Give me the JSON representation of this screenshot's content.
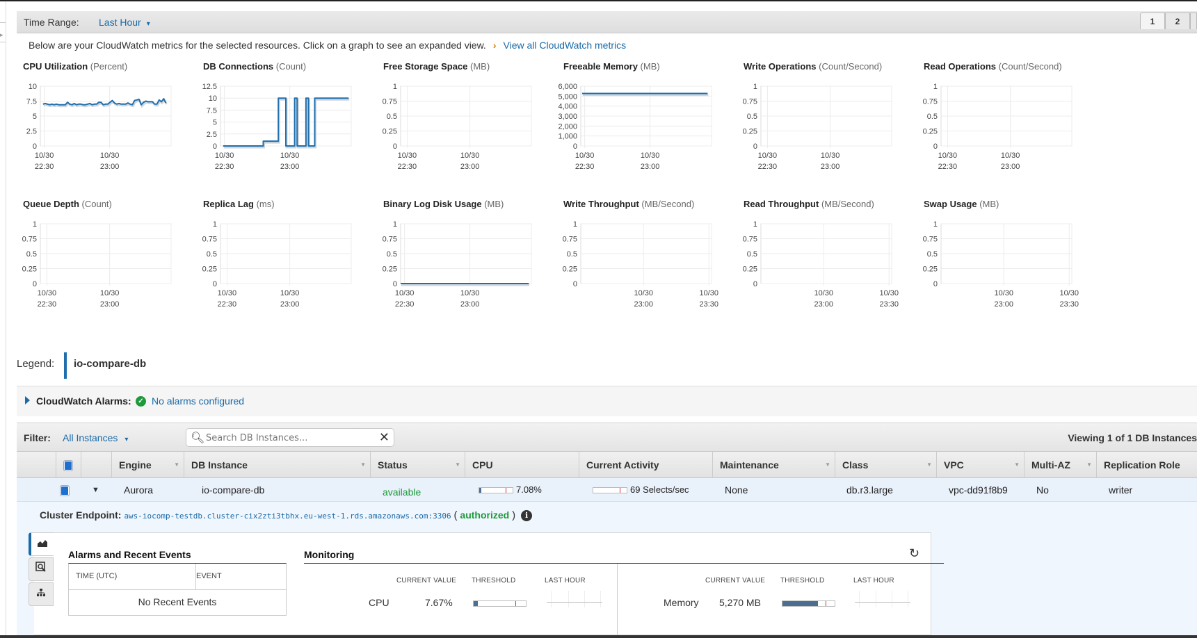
{
  "time_range": {
    "label": "Time Range:",
    "value": "Last Hour"
  },
  "pagination": [
    "1",
    "2"
  ],
  "intro": {
    "text": "Below are your CloudWatch metrics for the selected resources. Click on a graph to see an expanded view.",
    "link": "View all CloudWatch metrics"
  },
  "chart_data": [
    {
      "type": "line",
      "title": "CPU Utilization",
      "unit": "(Percent)",
      "ylim": [
        0,
        10
      ],
      "yticks": [
        "10",
        "7.5",
        "5",
        "2.5",
        "0"
      ],
      "ytick_values": [
        10,
        7.5,
        5,
        2.5,
        0
      ],
      "xticks": [
        {
          "date": "10/30",
          "time": "22:30",
          "pos": 0.03
        },
        {
          "date": "10/30",
          "time": "23:00",
          "pos": 0.53
        }
      ],
      "series": [
        {
          "name": "io-compare-db",
          "values": [
            7.0,
            7.1,
            7.0,
            6.9,
            7.0,
            6.9,
            7.0,
            6.9,
            6.9,
            6.9,
            6.9,
            7.3,
            7.0,
            6.9,
            7.1,
            6.9,
            7.0,
            7.0,
            6.9,
            6.9,
            7.0,
            7.1,
            6.9,
            7.0,
            7.0,
            7.3,
            7.3,
            6.9,
            7.0,
            7.0,
            7.3,
            7.6,
            7.2,
            7.0,
            7.1,
            7.0,
            7.0,
            7.0,
            7.2,
            7.0,
            6.9,
            7.6,
            7.7,
            7.8,
            6.9,
            7.3,
            7.5,
            7.4,
            7.4,
            7.4,
            7.0,
            7.0,
            7.7,
            7.4,
            7.9,
            7.2
          ]
        }
      ],
      "x_range": [
        0.02,
        0.96
      ]
    },
    {
      "type": "line",
      "step": true,
      "title": "DB Connections",
      "unit": "(Count)",
      "ylim": [
        0,
        12.5
      ],
      "yticks": [
        "12.5",
        "10",
        "7.5",
        "5",
        "2.5",
        "0"
      ],
      "ytick_values": [
        12.5,
        10,
        7.5,
        5,
        2.5,
        0
      ],
      "xticks": [
        {
          "date": "10/30",
          "time": "22:30",
          "pos": 0.03
        },
        {
          "date": "10/30",
          "time": "23:00",
          "pos": 0.53
        }
      ],
      "series": [
        {
          "name": "io-compare-db",
          "points": [
            [
              0.0,
              0
            ],
            [
              0.32,
              0
            ],
            [
              0.32,
              1
            ],
            [
              0.44,
              1
            ],
            [
              0.44,
              10
            ],
            [
              0.5,
              10
            ],
            [
              0.5,
              0
            ],
            [
              0.57,
              0
            ],
            [
              0.57,
              10
            ],
            [
              0.59,
              10
            ],
            [
              0.59,
              0
            ],
            [
              0.66,
              0
            ],
            [
              0.66,
              10
            ],
            [
              0.68,
              10
            ],
            [
              0.68,
              0
            ],
            [
              0.73,
              0
            ],
            [
              0.73,
              10
            ],
            [
              1.0,
              10
            ]
          ]
        }
      ],
      "x_range": [
        0.02,
        0.98
      ]
    },
    {
      "type": "line",
      "title": "Free Storage Space",
      "unit": "(MB)",
      "ylim": [
        0,
        1
      ],
      "yticks": [
        "1",
        "0.75",
        "0.5",
        "0.25",
        "0"
      ],
      "ytick_values": [
        1,
        0.75,
        0.5,
        0.25,
        0
      ],
      "xticks": [
        {
          "date": "10/30",
          "time": "22:30",
          "pos": 0.05
        },
        {
          "date": "10/30",
          "time": "23:00",
          "pos": 0.53
        }
      ],
      "series": []
    },
    {
      "type": "line",
      "title": "Freeable Memory",
      "unit": "(MB)",
      "ylim": [
        0,
        6000
      ],
      "yticks": [
        "6,000",
        "5,000",
        "4,000",
        "3,000",
        "2,000",
        "1,000",
        "0"
      ],
      "ytick_values": [
        6000,
        5000,
        4000,
        3000,
        2000,
        1000,
        0
      ],
      "xticks": [
        {
          "date": "10/30",
          "time": "22:30",
          "pos": 0.03
        },
        {
          "date": "10/30",
          "time": "23:00",
          "pos": 0.53
        }
      ],
      "series": [
        {
          "name": "io-compare-db",
          "points": [
            [
              0.0,
              5270
            ],
            [
              1.0,
              5270
            ]
          ]
        }
      ],
      "x_range": [
        0.01,
        0.97
      ]
    },
    {
      "type": "line",
      "title": "Write Operations",
      "unit": "(Count/Second)",
      "ylim": [
        0,
        1
      ],
      "yticks": [
        "1",
        "0.75",
        "0.5",
        "0.25",
        "0"
      ],
      "ytick_values": [
        1,
        0.75,
        0.5,
        0.25,
        0
      ],
      "xticks": [
        {
          "date": "10/30",
          "time": "22:30",
          "pos": 0.05
        },
        {
          "date": "10/30",
          "time": "23:00",
          "pos": 0.53
        }
      ],
      "series": []
    },
    {
      "type": "line",
      "title": "Read Operations",
      "unit": "(Count/Second)",
      "ylim": [
        0,
        1
      ],
      "yticks": [
        "1",
        "0.75",
        "0.5",
        "0.25",
        "0"
      ],
      "ytick_values": [
        1,
        0.75,
        0.5,
        0.25,
        0
      ],
      "xticks": [
        {
          "date": "10/30",
          "time": "22:30",
          "pos": 0.05
        },
        {
          "date": "10/30",
          "time": "23:00",
          "pos": 0.53
        }
      ],
      "series": []
    },
    {
      "type": "line",
      "title": "Queue Depth",
      "unit": "(Count)",
      "ylim": [
        0,
        1
      ],
      "yticks": [
        "1",
        "0.75",
        "0.5",
        "0.25",
        "0"
      ],
      "ytick_values": [
        1,
        0.75,
        0.5,
        0.25,
        0
      ],
      "xticks": [
        {
          "date": "10/30",
          "time": "22:30",
          "pos": 0.05
        },
        {
          "date": "10/30",
          "time": "23:00",
          "pos": 0.53
        }
      ],
      "series": []
    },
    {
      "type": "line",
      "title": "Replica Lag",
      "unit": "(ms)",
      "ylim": [
        0,
        1
      ],
      "yticks": [
        "1",
        "0.75",
        "0.5",
        "0.25",
        "0"
      ],
      "ytick_values": [
        1,
        0.75,
        0.5,
        0.25,
        0
      ],
      "xticks": [
        {
          "date": "10/30",
          "time": "22:30",
          "pos": 0.05
        },
        {
          "date": "10/30",
          "time": "23:00",
          "pos": 0.53
        }
      ],
      "series": []
    },
    {
      "type": "line",
      "title": "Binary Log Disk Usage",
      "unit": "(MB)",
      "ylim": [
        0,
        1
      ],
      "yticks": [
        "1",
        "0.75",
        "0.5",
        "0.25",
        "0"
      ],
      "ytick_values": [
        1,
        0.75,
        0.5,
        0.25,
        0
      ],
      "xticks": [
        {
          "date": "10/30",
          "time": "22:30",
          "pos": 0.03
        },
        {
          "date": "10/30",
          "time": "23:00",
          "pos": 0.53
        }
      ],
      "series": [
        {
          "name": "io-compare-db",
          "points": [
            [
              0.0,
              0
            ],
            [
              1.0,
              0
            ]
          ]
        }
      ],
      "x_range": [
        0.0,
        0.98
      ]
    },
    {
      "type": "line",
      "title": "Write Throughput",
      "unit": "(MB/Second)",
      "ylim": [
        0,
        1
      ],
      "yticks": [
        "1",
        "0.75",
        "0.5",
        "0.25",
        "0"
      ],
      "ytick_values": [
        1,
        0.75,
        0.5,
        0.25,
        0
      ],
      "xticks": [
        {
          "date": "10/30",
          "time": "23:00",
          "pos": 0.48
        },
        {
          "date": "10/30",
          "time": "23:30",
          "pos": 0.98
        }
      ],
      "series": []
    },
    {
      "type": "line",
      "title": "Read Throughput",
      "unit": "(MB/Second)",
      "ylim": [
        0,
        1
      ],
      "yticks": [
        "1",
        "0.75",
        "0.5",
        "0.25",
        "0"
      ],
      "ytick_values": [
        1,
        0.75,
        0.5,
        0.25,
        0
      ],
      "xticks": [
        {
          "date": "10/30",
          "time": "23:00",
          "pos": 0.48
        },
        {
          "date": "10/30",
          "time": "23:30",
          "pos": 0.98
        }
      ],
      "series": []
    },
    {
      "type": "line",
      "title": "Swap Usage",
      "unit": "(MB)",
      "ylim": [
        0,
        1
      ],
      "yticks": [
        "1",
        "0.75",
        "0.5",
        "0.25",
        "0"
      ],
      "ytick_values": [
        1,
        0.75,
        0.5,
        0.25,
        0
      ],
      "xticks": [
        {
          "date": "10/30",
          "time": "23:00",
          "pos": 0.48
        },
        {
          "date": "10/30",
          "time": "23:30",
          "pos": 0.98
        }
      ],
      "series": []
    }
  ],
  "legend": {
    "label": "Legend:",
    "item": "io-compare-db",
    "color": "#1f6fae"
  },
  "alarms": {
    "label": "CloudWatch Alarms:",
    "status": "No alarms configured"
  },
  "filter": {
    "label": "Filter:",
    "value": "All Instances",
    "search_placeholder": "Search DB Instances...",
    "viewing": "Viewing 1 of 1 DB Instances"
  },
  "table": {
    "columns": [
      "Engine",
      "DB Instance",
      "Status",
      "CPU",
      "Current Activity",
      "Maintenance",
      "Class",
      "VPC",
      "Multi-AZ",
      "Replication Role"
    ],
    "row": {
      "engine": "Aurora",
      "instance": "io-compare-db",
      "status": "available",
      "cpu": "7.08%",
      "cpu_fraction": 0.07,
      "cpu_threshold": 0.8,
      "activity": "69 Selects/sec",
      "activity_threshold": 0.8,
      "maintenance": "None",
      "class": "db.r3.large",
      "vpc": "vpc-dd91f8b9",
      "multi_az": "No",
      "role": "writer"
    }
  },
  "detail": {
    "endpoint_label": "Cluster Endpoint:",
    "endpoint": "aws-iocomp-testdb.cluster-cix2zti3tbhx.eu-west-1.rds.amazonaws.com:3306",
    "authorized": "authorized",
    "alarms_title": "Alarms and Recent Events",
    "col_time": "TIME (UTC)",
    "col_event": "EVENT",
    "no_events": "No Recent Events",
    "monitoring_title": "Monitoring",
    "headers": {
      "current": "CURRENT VALUE",
      "threshold": "THRESHOLD",
      "last_hour": "LAST HOUR"
    },
    "metrics": [
      {
        "name": "CPU",
        "value": "7.67%",
        "fraction": 0.08,
        "threshold": 0.8
      },
      {
        "name": "Memory",
        "value": "5,270 MB",
        "fraction": 0.68,
        "threshold": 0.82
      }
    ]
  }
}
